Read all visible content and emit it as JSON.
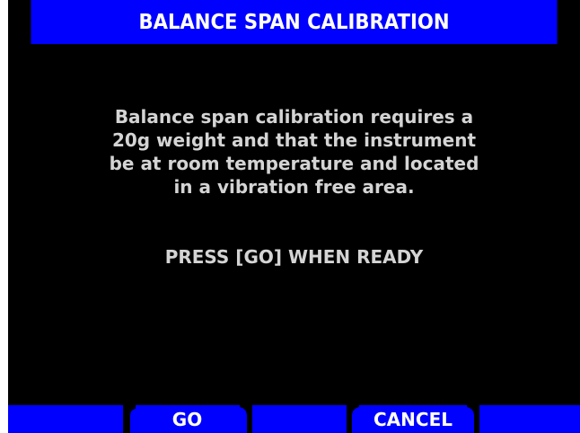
{
  "title": "BALANCE SPAN CALIBRATION",
  "message_lines": [
    "Balance span calibration requires a",
    "20g weight and that the instrument",
    "be at room temperature and located",
    "in a vibration free area."
  ],
  "prompt": "PRESS [GO] WHEN READY",
  "softkeys": [
    {
      "label": ""
    },
    {
      "label": "GO"
    },
    {
      "label": ""
    },
    {
      "label": "CANCEL"
    },
    {
      "label": ""
    }
  ],
  "colors": {
    "title_bar": "#0000ff",
    "softkey_bar": "#0000ff",
    "screen_bg": "#000000",
    "text": "#d4d4d4",
    "title_text": "#ffffff"
  }
}
